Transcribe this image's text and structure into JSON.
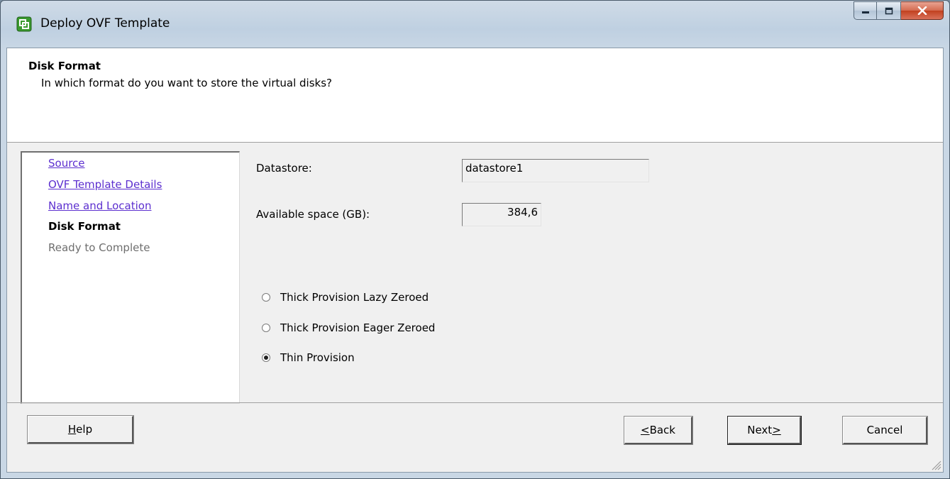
{
  "window": {
    "title": "Deploy OVF Template",
    "icon": "vsphere-app-icon"
  },
  "header": {
    "title": "Disk Format",
    "subtitle": "In which format do you want to store the virtual disks?"
  },
  "steps": [
    {
      "label": "Source",
      "state": "link"
    },
    {
      "label": "OVF Template Details",
      "state": "link"
    },
    {
      "label": "Name and Location",
      "state": "link"
    },
    {
      "label": "Disk Format",
      "state": "current"
    },
    {
      "label": "Ready to Complete",
      "state": "future"
    }
  ],
  "form": {
    "datastore_label": "Datastore:",
    "datastore_value": "datastore1",
    "space_label": "Available space (GB):",
    "space_value": "384,6"
  },
  "options": [
    {
      "label": "Thick Provision Lazy Zeroed",
      "checked": false
    },
    {
      "label": "Thick Provision Eager Zeroed",
      "checked": false
    },
    {
      "label": "Thin Provision",
      "checked": true
    }
  ],
  "buttons": {
    "help": {
      "mnemonic": "H",
      "rest": "elp"
    },
    "back": {
      "prefix": "",
      "mnemonic": "<",
      "rest": " Back"
    },
    "next": {
      "prefix": "Next ",
      "mnemonic": ">",
      "rest": ""
    },
    "cancel": "Cancel"
  }
}
